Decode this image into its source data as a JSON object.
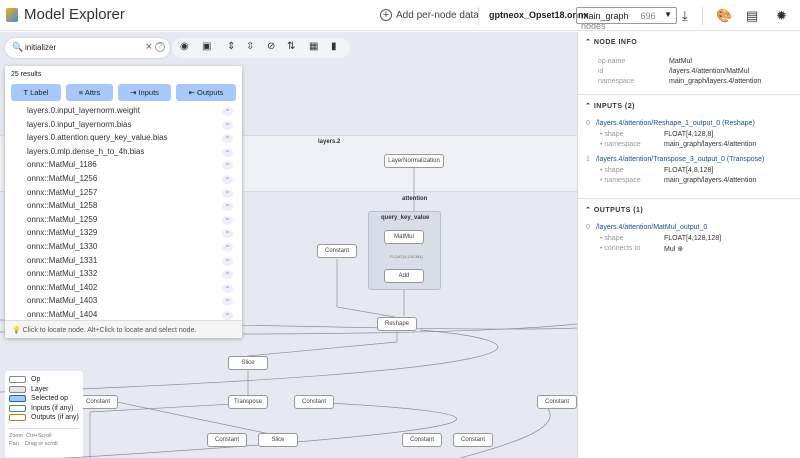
{
  "header": {
    "title": "Model Explorer",
    "add_data": "Add per-node data",
    "file": "gptneox_Opset18.onnx",
    "graph_select": "main_graph",
    "node_count": "696 nodes"
  },
  "search": {
    "value": "initializer",
    "count": "25 results",
    "filters": [
      "Label",
      "Attrs",
      "Inputs",
      "Outputs"
    ],
    "results": [
      "layers.0.input_layernorm.weight",
      "layers.0.input_layernorm.bias",
      "layers.0.attention.query_key_value.bias",
      "layers.0.mlp.dense_h_to_4h.bias",
      "onnx::MatMul_1186",
      "onnx::MatMul_1256",
      "onnx::MatMul_1257",
      "onnx::MatMul_1258",
      "onnx::MatMul_1259",
      "onnx::MatMul_1329",
      "onnx::MatMul_1330",
      "onnx::MatMul_1331",
      "onnx::MatMul_1332",
      "onnx::MatMul_1402",
      "onnx::MatMul_1403",
      "onnx::MatMul_1404"
    ],
    "hint": "Click to locate node. Alt+Click to locate and select node."
  },
  "graph": {
    "layers": "layers.2",
    "attention": "attention",
    "qkv": "query_key_value",
    "nodes": {
      "layernorm": "LayerNormalization",
      "matmul": "MatMul",
      "add": "Add",
      "constant": "Constant",
      "reshape": "Reshape",
      "slice": "Slice",
      "transpose": "Transpose"
    },
    "edge_labels": {
      "matmul_add": "FLOAT[4,128,384]"
    }
  },
  "legend": {
    "items": [
      "Op",
      "Layer",
      "Selected op",
      "Inputs (if any)",
      "Outputs (if any)"
    ],
    "zoom_k": "Zoom",
    "zoom_v": "Ctrl+Scroll",
    "pan_k": "Pan",
    "pan_v": "Drag or scroll"
  },
  "colors": {
    "selected": "#a8c7fa",
    "inputs": "#2e9e5b",
    "outputs": "#d86a2c",
    "accent": "#1a4f9c"
  },
  "node_info": {
    "header": "NODE INFO",
    "op_name_k": "op name",
    "op_name": "MatMul",
    "id_k": "id",
    "id": "/layers.4/attention/MatMul",
    "ns_k": "namespace",
    "ns": "main_graph/layers.4/attention"
  },
  "inputs": {
    "header": "INPUTS (2)",
    "items": [
      {
        "idx": "0",
        "name": "/layers.4/attention/Reshape_1_output_0 (Reshape)",
        "shape_k": "shape",
        "shape": "FLOAT[4,128,8]",
        "ns_k": "namespace",
        "ns": "main_graph/layers.4/attention"
      },
      {
        "idx": "1",
        "name": "/layers.4/attention/Transpose_3_output_0 (Transpose)",
        "shape_k": "shape",
        "shape": "FLOAT[4,8,128]",
        "ns_k": "namespace",
        "ns": "main_graph/layers.4/attention"
      }
    ]
  },
  "outputs": {
    "header": "OUTPUTS (1)",
    "idx": "0",
    "name": "/layers.4/attention/MatMul_output_0",
    "shape_k": "shape",
    "shape": "FLOAT[4,128,128]",
    "conn_k": "connects to",
    "conn": "Mul"
  }
}
